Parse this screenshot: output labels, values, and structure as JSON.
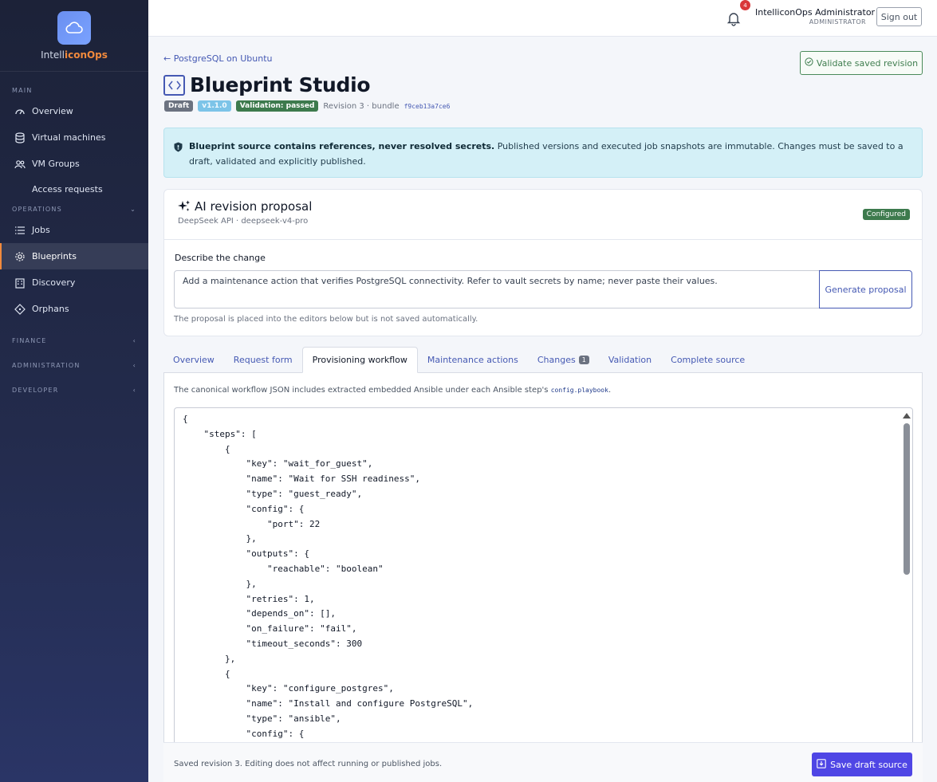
{
  "brand": {
    "prefix": "Intell",
    "accent": "iconOps"
  },
  "sidebar": {
    "sections": [
      {
        "label": "MAIN"
      },
      {
        "label": "OPERATIONS"
      },
      {
        "label": "FINANCE"
      },
      {
        "label": "ADMINISTRATION"
      },
      {
        "label": "DEVELOPER"
      }
    ],
    "items": [
      {
        "label": "Overview",
        "icon": "gauge-icon"
      },
      {
        "label": "Virtual machines",
        "icon": "database-icon"
      },
      {
        "label": "VM Groups",
        "icon": "users-icon"
      },
      {
        "label": "Access requests"
      },
      {
        "label": "Jobs",
        "icon": "list-icon"
      },
      {
        "label": "Blueprints",
        "icon": "gear-icon",
        "active": true
      },
      {
        "label": "Discovery",
        "icon": "building-icon"
      },
      {
        "label": "Orphans",
        "icon": "diamond-icon"
      }
    ]
  },
  "topbar": {
    "notification_count": "4",
    "user_name": "IntelliconOps Administrator",
    "user_role": "ADMINISTRATOR",
    "signout_label": "Sign out"
  },
  "header": {
    "back_label": "← PostgreSQL on Ubuntu",
    "title": "Blueprint Studio",
    "validate_label": "Validate saved revision",
    "badges": {
      "draft": "Draft",
      "version": "v1.1.0",
      "validation": "Validation: passed"
    },
    "revision_text": "Revision 3 · bundle",
    "bundle_hash": "f9ceb13a7ce6"
  },
  "info": {
    "bold": "Blueprint source contains references, never resolved secrets.",
    "text": " Published versions and executed job snapshots are immutable. Changes must be saved to a draft, validated and explicitly published."
  },
  "ai": {
    "title": "AI revision proposal",
    "subtitle": "DeepSeek API · deepseek-v4-pro",
    "status": "Configured",
    "describe_label": "Describe the change",
    "prompt_value": "Add a maintenance action that verifies PostgreSQL connectivity. Refer to vault secrets by name; never paste their values.",
    "generate_label": "Generate proposal",
    "note": "The proposal is placed into the editors below but is not saved automatically."
  },
  "tabs": [
    {
      "label": "Overview"
    },
    {
      "label": "Request form"
    },
    {
      "label": "Provisioning workflow",
      "active": true
    },
    {
      "label": "Maintenance actions"
    },
    {
      "label": "Changes",
      "count": "1"
    },
    {
      "label": "Validation"
    },
    {
      "label": "Complete source"
    }
  ],
  "panel": {
    "hint_prefix": "The canonical workflow JSON includes extracted embedded Ansible under each Ansible step's ",
    "hint_code": "config.playbook",
    "hint_suffix": ".",
    "code": "{\n    \"steps\": [\n        {\n            \"key\": \"wait_for_guest\",\n            \"name\": \"Wait for SSH readiness\",\n            \"type\": \"guest_ready\",\n            \"config\": {\n                \"port\": 22\n            },\n            \"outputs\": {\n                \"reachable\": \"boolean\"\n            },\n            \"retries\": 1,\n            \"depends_on\": [],\n            \"on_failure\": \"fail\",\n            \"timeout_seconds\": 300\n        },\n        {\n            \"key\": \"configure_postgres\",\n            \"name\": \"Install and configure PostgreSQL\",\n            \"type\": \"ansible\",\n            \"config\": {"
  },
  "footer": {
    "note": "Saved revision 3. Editing does not affect running or published jobs.",
    "save_label": "Save draft source"
  }
}
